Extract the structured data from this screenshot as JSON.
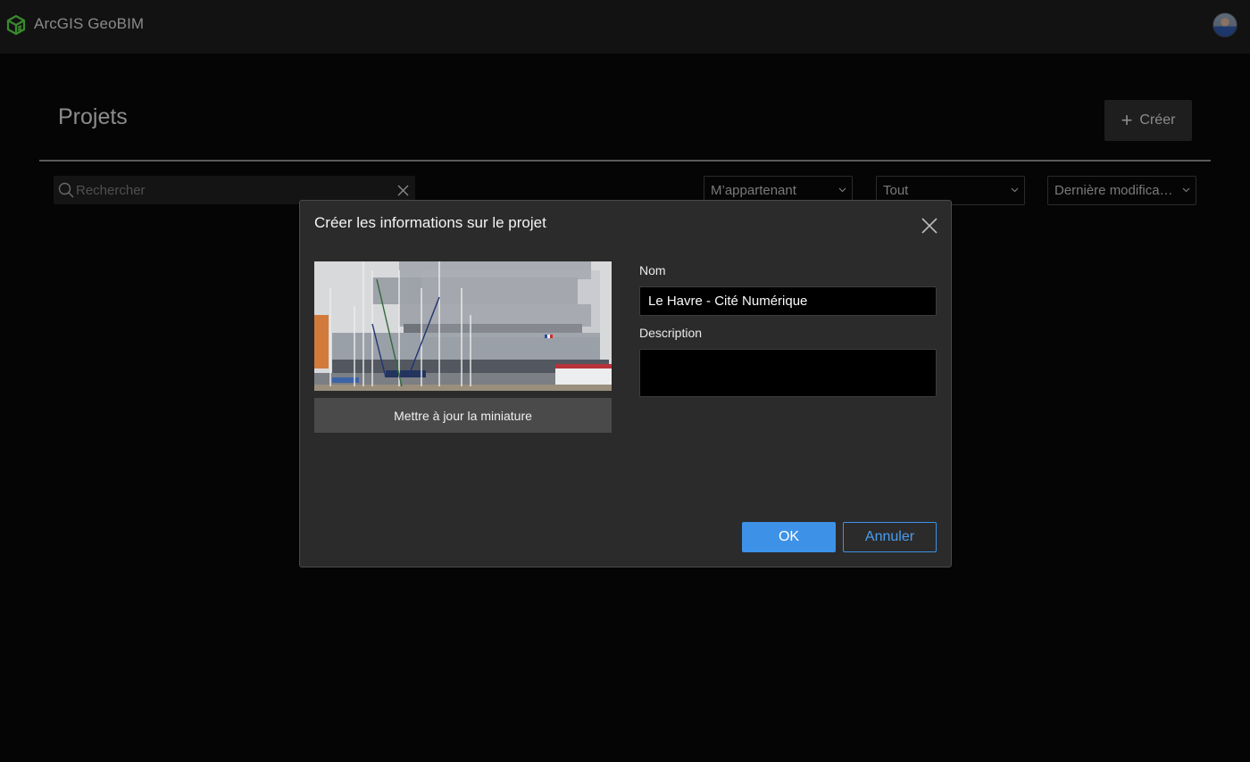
{
  "header": {
    "app_title": "ArcGIS GeoBIM",
    "logo_icon": "geobim-cube-icon",
    "avatar_icon": "user-avatar",
    "brand_color": "#3a8a2e"
  },
  "page": {
    "title": "Projets",
    "create_label": "Créer",
    "create_icon": "plus-icon"
  },
  "filters": {
    "search": {
      "placeholder": "Rechercher",
      "value": "",
      "icon": "search-icon",
      "clear_icon": "close-icon"
    },
    "owner": {
      "selected": "M’appartenant"
    },
    "type": {
      "selected": "Tout"
    },
    "sort": {
      "selected": "Dernière modifica…"
    }
  },
  "dialog": {
    "title": "Créer les informations sur le projet",
    "close_icon": "close-icon",
    "thumbnail_alt": "Photo du bâtiment Cité Numérique au Havre avec voiliers",
    "update_thumbnail_label": "Mettre à jour la miniature",
    "name_label": "Nom",
    "name_value": "Le Havre - Cité Numérique",
    "description_label": "Description",
    "description_value": "",
    "ok_label": "OK",
    "cancel_label": "Annuler",
    "accent_color": "#3d92e8"
  }
}
